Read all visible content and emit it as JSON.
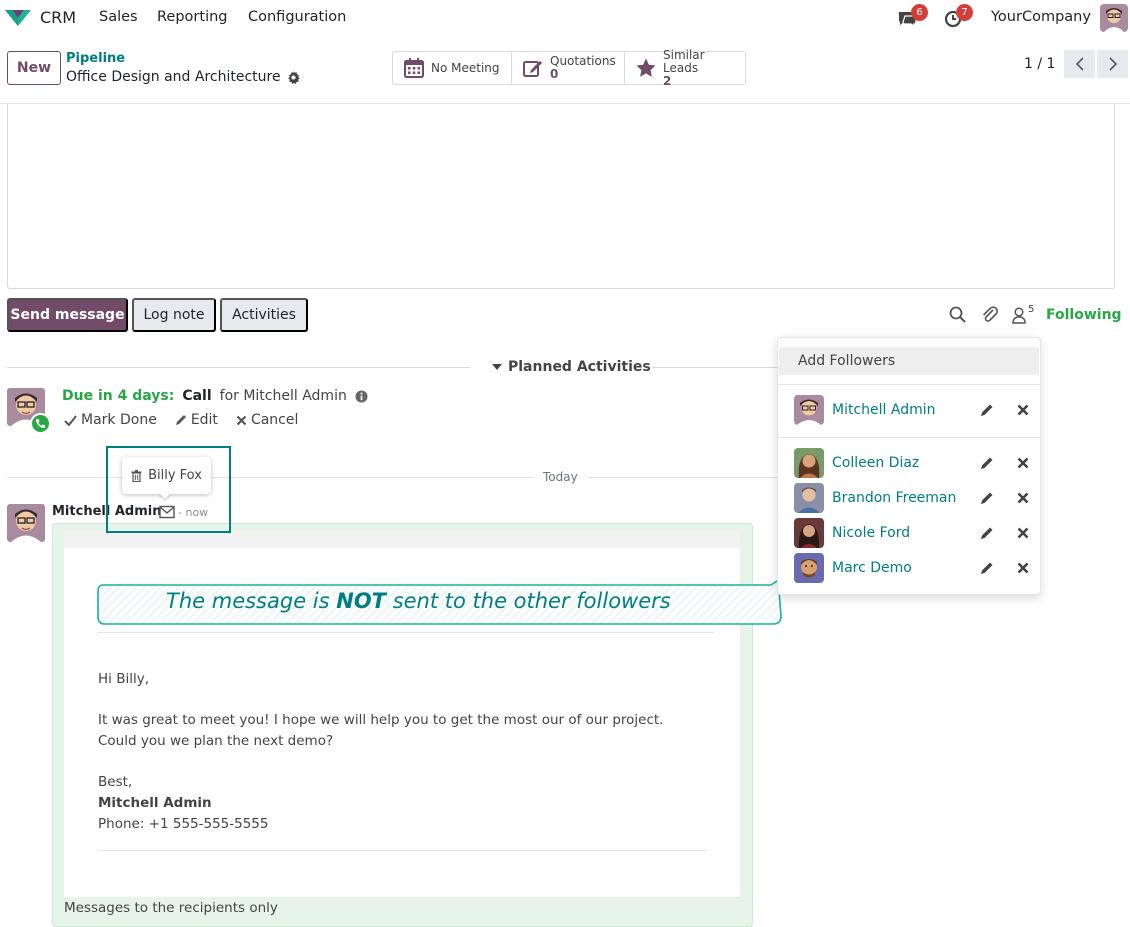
{
  "navbar": {
    "app_name": "CRM",
    "menu": [
      "Sales",
      "Reporting",
      "Configuration"
    ],
    "messages_badge": "6",
    "activities_badge": "7",
    "company": "YourCompany"
  },
  "control_panel": {
    "new_label": "New",
    "breadcrumb_parent": "Pipeline",
    "record_title": "Office Design and Architecture",
    "smart_buttons": {
      "meeting": {
        "label": "No Meeting"
      },
      "quotations": {
        "label": "Quotations",
        "value": "0"
      },
      "similar": {
        "label": "Similar Leads",
        "value": "2"
      }
    },
    "pager": "1 / 1"
  },
  "chatter": {
    "send_message": "Send message",
    "log_note": "Log note",
    "activities": "Activities",
    "followers_count": "5",
    "following": "Following",
    "planned_activities": "Planned Activities",
    "activity": {
      "due": "Due in 4 days:",
      "type": "Call",
      "for": "for Mitchell Admin",
      "mark_done": "Mark Done",
      "edit": "Edit",
      "cancel": "Cancel"
    },
    "today": "Today",
    "tooltip_recipient": "Billy Fox",
    "message": {
      "author": "Mitchell Admin",
      "time": "- now",
      "greeting": "Hi Billy,",
      "line1": "It was great to meet you! I hope we will help you to get the most our of our project.",
      "line2": "Could you we plan the next demo?",
      "closing": "Best,",
      "sig_name": "Mitchell Admin",
      "sig_phone": "Phone: +1 555-555-5555",
      "footer": "Messages to the recipients only"
    }
  },
  "callout": {
    "before": "The message is ",
    "emphasis": "NOT",
    "after": " sent to the other followers"
  },
  "followers_panel": {
    "add_followers": "Add Followers",
    "followers": [
      {
        "name": "Mitchell Admin"
      },
      {
        "name": "Colleen Diaz"
      },
      {
        "name": "Brandon Freeman"
      },
      {
        "name": "Nicole Ford"
      },
      {
        "name": "Marc Demo"
      }
    ]
  },
  "colors": {
    "brand": "#714b67",
    "link_teal": "#017e84",
    "success": "#28a745",
    "badge_red": "#d23f3a",
    "message_bg": "#e7f4ea"
  }
}
